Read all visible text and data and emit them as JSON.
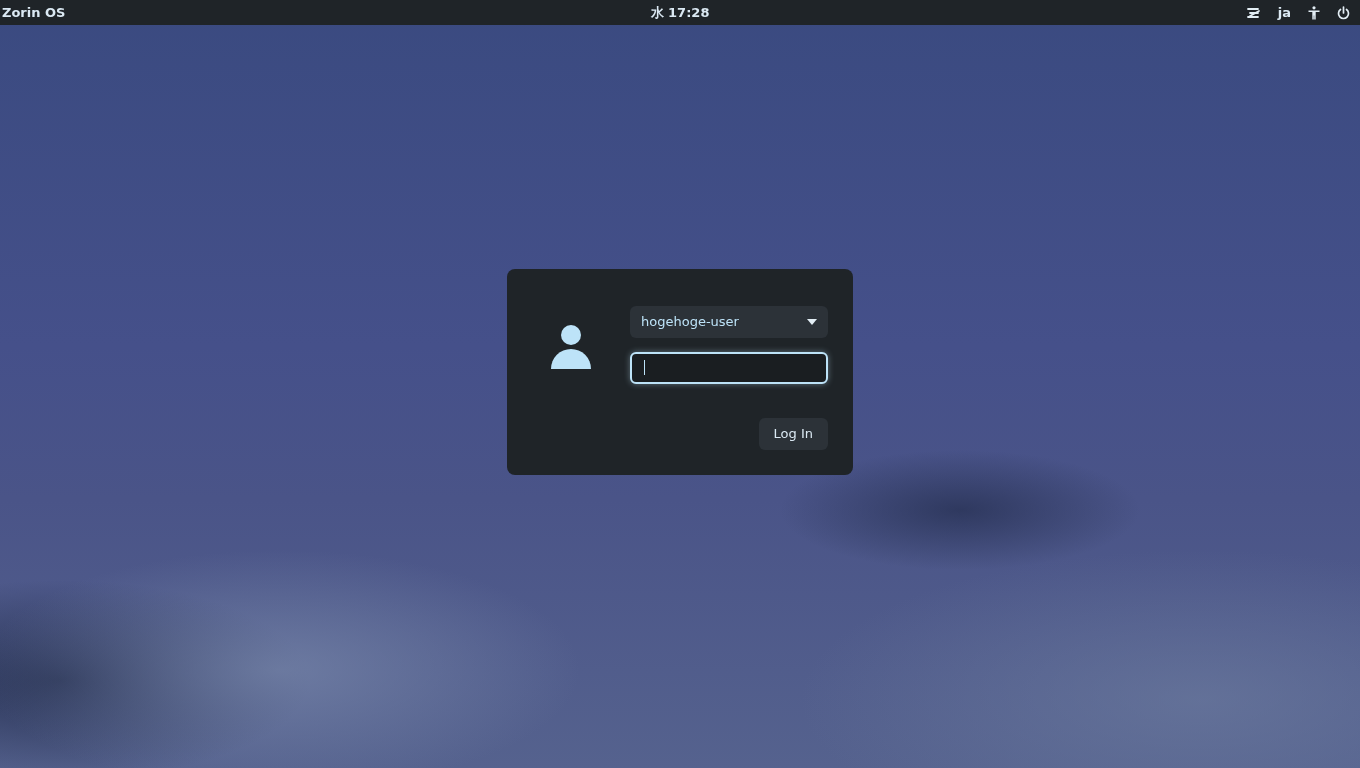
{
  "top_bar": {
    "label": "Zorin OS",
    "clock": "水 17:28",
    "keyboard_layout": "ja"
  },
  "login": {
    "user": "hogehoge-user",
    "password_field": {
      "focused": true
    },
    "button": "Log In"
  }
}
